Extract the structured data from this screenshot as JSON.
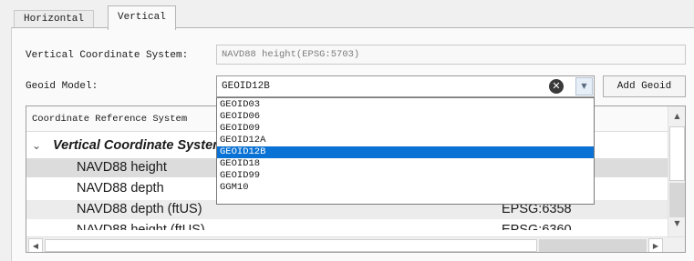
{
  "tabs": [
    {
      "label": "Horizontal"
    },
    {
      "label": "Vertical"
    }
  ],
  "form": {
    "vcs_label": "Vertical Coordinate System:",
    "vcs_value": "NAVD88 height(EPSG:5703)",
    "geoid_label": "Geoid Model:",
    "geoid_value": "GEOID12B",
    "add_geoid_label": "Add Geoid"
  },
  "icons": {
    "clear": "clear-icon",
    "dropdown": "chevron-down-icon",
    "expand": "chevron-down-icon"
  },
  "dropdown": {
    "options": [
      "GEOID03",
      "GEOID06",
      "GEOID09",
      "GEOID12A",
      "GEOID12B",
      "GEOID18",
      "GEOID99",
      "GGM10"
    ],
    "selected": "GEOID12B"
  },
  "table": {
    "header": "Coordinate Reference System",
    "group_label": "Vertical Coordinate Systems",
    "rows": [
      {
        "name": "NAVD88 height",
        "code": ""
      },
      {
        "name": "NAVD88 depth",
        "code": ""
      },
      {
        "name": "NAVD88 depth (ftUS)",
        "code": "EPSG:6358"
      },
      {
        "name": "NAVD88 height (ftUS)",
        "code": "EPSG:6360"
      }
    ]
  },
  "colors": {
    "selection": "#0a72d4",
    "selected_row": "#dcdcdc"
  }
}
